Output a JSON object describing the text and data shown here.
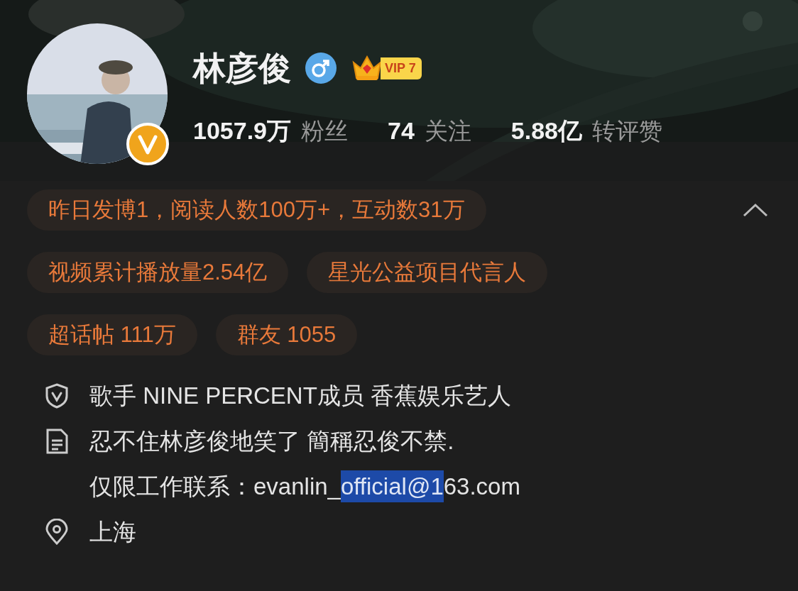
{
  "profile": {
    "name": "林彦俊",
    "male": true,
    "verified": true,
    "vip": {
      "label": "VIP 7"
    }
  },
  "stats": [
    {
      "count": "1057.9万",
      "name": "粉丝"
    },
    {
      "count": "74",
      "name": "关注"
    },
    {
      "count": "5.88亿",
      "name": "转评赞"
    }
  ],
  "chips": [
    {
      "text": "昨日发博1，阅读人数100万+，互动数31万"
    },
    {
      "text": "视频累计播放量2.54亿"
    },
    {
      "text": "星光公益项目代言人"
    },
    {
      "text": "超话帖 111万"
    },
    {
      "text": "群友 1055"
    }
  ],
  "chips_expanded": true,
  "info": [
    {
      "kind": "verified",
      "lines": [
        [
          {
            "text": "歌手 NINE PERCENT成员 香蕉娱乐艺人",
            "highlighted": false
          }
        ]
      ]
    },
    {
      "kind": "bio",
      "lines": [
        [
          {
            "text": "忍不住林彦俊地笑了 簡稱忍俊不禁.",
            "highlighted": false
          }
        ],
        [
          {
            "text": "仅限工作联系：evanlin_",
            "highlighted": false
          },
          {
            "text": "official@1",
            "highlighted": true
          },
          {
            "text": "63.com",
            "highlighted": false
          }
        ]
      ]
    },
    {
      "kind": "location",
      "lines": [
        [
          {
            "text": "上海",
            "highlighted": false
          }
        ]
      ]
    }
  ]
}
